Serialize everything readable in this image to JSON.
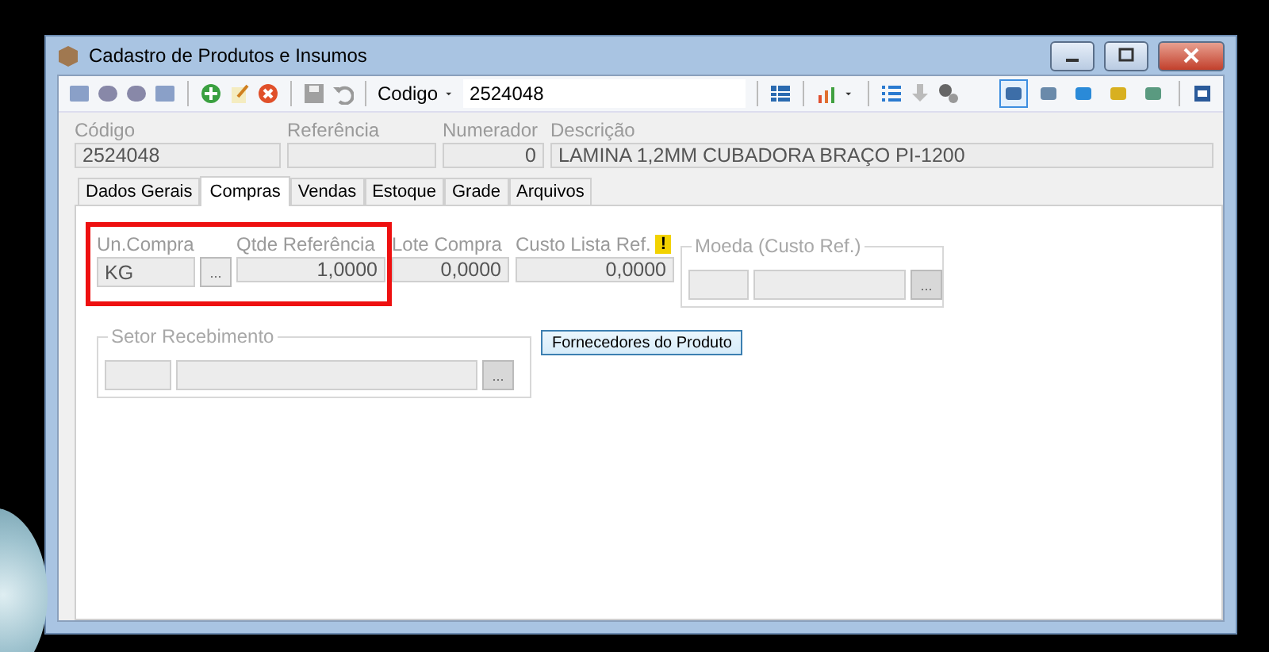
{
  "window": {
    "title": "Cadastro de Produtos e Insumos"
  },
  "toolbar": {
    "nav_tools": [
      {
        "kind": "first"
      },
      {
        "kind": "prev"
      },
      {
        "kind": "next"
      },
      {
        "kind": "last"
      }
    ],
    "search_label": "Codigo",
    "search_value": "2524048",
    "right_tools": [
      {
        "selected": true
      },
      {
        "selected": false
      },
      {
        "selected": false
      },
      {
        "selected": false
      },
      {
        "selected": false
      }
    ]
  },
  "header_fields": [
    {
      "label": "Código",
      "value": "2524048",
      "kind": "text"
    },
    {
      "label": "Referência",
      "kind": "text"
    },
    {
      "label": "Numerador",
      "value": "0",
      "kind": "number"
    },
    {
      "label": "Descrição",
      "value": "LAMINA 1,2MM CUBADORA BRAÇO PI-1200",
      "kind": "text"
    }
  ],
  "tabs": [
    {
      "label": "Dados Gerais",
      "selected": false
    },
    {
      "label": "Compras",
      "selected": true
    },
    {
      "label": "Vendas",
      "selected": false
    },
    {
      "label": "Estoque",
      "selected": false
    },
    {
      "label": "Grade",
      "selected": false
    },
    {
      "label": "Arquivos",
      "selected": false
    }
  ],
  "compras": {
    "un_compra": {
      "label": "Un.Compra",
      "value": "KG",
      "button": "...",
      "disabled": false
    },
    "qtde_referencia": {
      "label": "Qtde Referência",
      "value": "1,0000"
    },
    "lote_compra": {
      "label": "Lote Compra",
      "value": "0,0000"
    },
    "custo_lista_ref": {
      "label": "Custo Lista Ref.",
      "value": "0,0000",
      "warning": "!"
    },
    "moeda": {
      "label": "Moeda (Custo Ref.)",
      "button": "...",
      "disabled": true
    },
    "setor_recebimento": {
      "label": "Setor Recebimento",
      "button": "...",
      "disabled": true
    },
    "fornecedores_button": "Fornecedores do Produto"
  }
}
